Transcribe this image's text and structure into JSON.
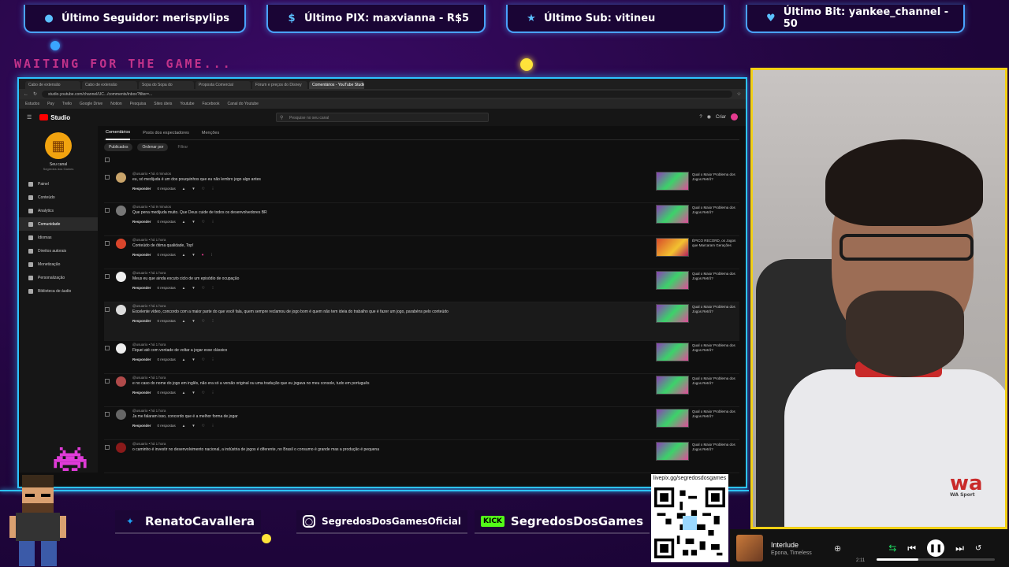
{
  "alerts": [
    {
      "icon": "user-icon",
      "text": "Último Seguidor: merispylips"
    },
    {
      "icon": "dollar-icon",
      "text": "Último PIX: maxvianna - R$5"
    },
    {
      "icon": "star-icon",
      "text": "Último Sub: vitineu"
    },
    {
      "icon": "gem-icon",
      "text": "Último Bit: yankee_channel - 50"
    }
  ],
  "waiting_text": "WAITING FOR THE GAME...",
  "browser": {
    "tabs": [
      "Cabo de extensão",
      "Cabo de extensão",
      "Sopa do Sopa do",
      "Proposta Comercial",
      "Fórum e preços do Disney",
      "Comentários - YouTube Studio"
    ],
    "url": "studio.youtube.com/channel/UC.../comments/inbox?filter=...",
    "bookmarks": [
      "Estudos",
      "Pay",
      "Trello",
      "Google Drive",
      "Notion",
      "Pesquisa",
      "Sites úteis",
      "Youtube",
      "Facebook",
      "Canal do Youtube"
    ]
  },
  "studio": {
    "logo": "Studio",
    "search_placeholder": "Pesquise no seu canal",
    "create_label": "Criar",
    "channel_name": "Seu canal",
    "channel_sub": "Segredos dos Games",
    "sidebar": [
      "Painel",
      "Conteúdo",
      "Analytics",
      "Comunidade",
      "Idiomas",
      "Direitos autorais",
      "Monetização",
      "Personalização",
      "Biblioteca de áudio"
    ],
    "sidebar_active_index": 3,
    "tabs": [
      "Comentários",
      "Posts dos espectadores",
      "Menções"
    ],
    "filters": [
      "Publicados",
      "Ordenar por",
      "Filtrar"
    ],
    "reply_label": "Responder",
    "replies_label": "0 respostas",
    "comments": [
      {
        "meta": "@usuario • há 4 minutos",
        "text": "eu, só medijuda é um dos pouquinhos que eu não lembro jogo algo antes",
        "video": "Qual o Maior Problema dos Jogos Retrô?"
      },
      {
        "meta": "@usuario • há 9 minutos",
        "text": "Que pena medijuda muito. Que Deus cuide de todos os desenvolvedores BR",
        "video": "Qual o Maior Problema dos Jogos Retrô?"
      },
      {
        "meta": "@usuario • há 1 hora",
        "text": "Conteúdo de ótima qualidade, Top!",
        "video": "ÉPICO RECORD, os Jogos que Marcaram Gerações"
      },
      {
        "meta": "@usuario • há 1 hora",
        "text": "Meus eu que ainda escuto ciclo de um episódio de ocupação",
        "video": "Qual o Maior Problema dos Jogos Retrô?"
      },
      {
        "meta": "@usuario • há 1 hora",
        "text": "Excelente vídeo, concordo com a maior parte do que você fala, quem sempre reclamou de jogo bom é quem não tem ideia do trabalho que é fazer um jogo, parabéns pelo conteúdo",
        "video": "Qual o Maior Problema dos Jogos Retrô?"
      },
      {
        "meta": "@usuario • há 1 hora",
        "text": "Fiquei até com vontade de voltar a jogar esse clássico",
        "video": "Qual o Maior Problema dos Jogos Retrô?"
      },
      {
        "meta": "@usuario • há 1 hora",
        "text": "e no caso do nome do jogo em inglês, não era só a versão original ou uma tradução que eu jogava no meu console, tudo em português",
        "video": "Qual o Maior Problema dos Jogos Retrô?"
      },
      {
        "meta": "@usuario • há 1 hora",
        "text": "Ja me falaram isso, concordo que é a melhor forma de jogar",
        "video": "Qual o Maior Problema dos Jogos Retrô?"
      },
      {
        "meta": "@usuario • há 1 hora",
        "text": "o caminho é investir no desenvolvimento nacional, a indústria de jogos é diferente, no Brasil o consumo é grande mas a produção é pequena",
        "video": "Qual o Maior Problema dos Jogos Retrô?"
      }
    ]
  },
  "social": {
    "twitter": "RenatoCavallera",
    "instagram": "SegredosDosGamesOficial",
    "kick_badge": "KICK",
    "kick": "SegredosDosGames"
  },
  "qr_label": "livepix.gg/segredosdosgames",
  "player": {
    "title": "Interlude",
    "artist": "Epona, Timeless",
    "time": "2:11",
    "progress": 0.35
  },
  "colors": {
    "accent_blue": "#2ec3ff",
    "cam_border": "#f2d016",
    "background": "#22063f"
  }
}
